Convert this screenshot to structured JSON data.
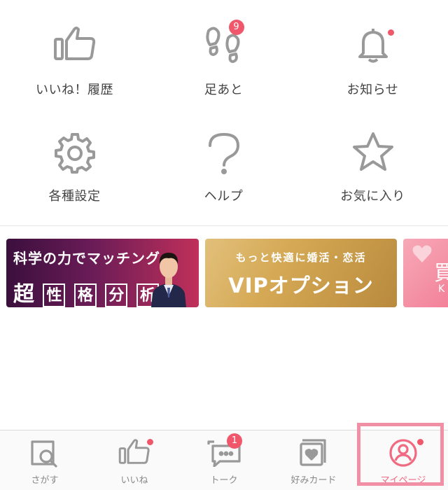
{
  "menu": {
    "items": [
      {
        "label": "いいね！履歴",
        "icon": "thumbs-up-icon"
      },
      {
        "label": "足あと",
        "icon": "footprints-icon",
        "badge": "9"
      },
      {
        "label": "お知らせ",
        "icon": "bell-icon",
        "dot": true
      },
      {
        "label": "各種設定",
        "icon": "gear-icon"
      },
      {
        "label": "ヘルプ",
        "icon": "question-icon"
      },
      {
        "label": "お気に入り",
        "icon": "star-icon"
      }
    ]
  },
  "banners": [
    {
      "line1": "科学の力でマッチング",
      "line2_big": "超",
      "line2_boxes": [
        "性",
        "格",
        "分",
        "析"
      ]
    },
    {
      "line1": "もっと快適に婚活・恋活",
      "line2": "VIPオプション"
    },
    {
      "line1": "買",
      "line2": "K"
    }
  ],
  "tabbar": {
    "tabs": [
      {
        "label": "さがす",
        "icon": "search-icon"
      },
      {
        "label": "いいね",
        "icon": "thumbs-up-icon",
        "dot": true
      },
      {
        "label": "トーク",
        "icon": "chat-bubble-icon",
        "badge": "1"
      },
      {
        "label": "好みカード",
        "icon": "heart-card-icon"
      },
      {
        "label": "マイページ",
        "icon": "profile-icon",
        "dot": true,
        "active": true
      }
    ]
  },
  "colors": {
    "accent": "#f0576a",
    "icon_gray": "#999999",
    "active_pink": "#f06a82"
  }
}
